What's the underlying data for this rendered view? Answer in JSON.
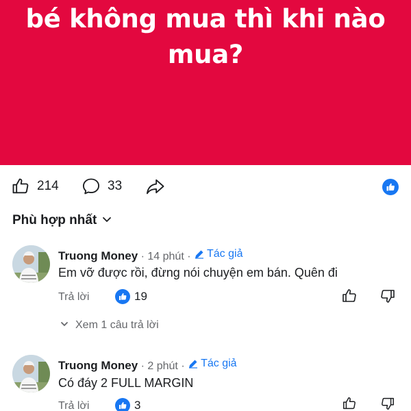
{
  "post": {
    "banner_line1": "bé không mua thì khi nào",
    "banner_line2": "mua?",
    "banner_color": "#e3083f"
  },
  "actions": {
    "like_count": "214",
    "comment_count": "33",
    "like_icon": "thumbs-up-icon",
    "comment_icon": "comment-bubble-icon",
    "share_icon": "share-arrow-icon"
  },
  "sort": {
    "label": "Phù hợp nhất"
  },
  "comments": [
    {
      "name": "Truong Money",
      "time": " · 14 phút · ",
      "author_badge": "Tác giả",
      "text": "Em vỡ được rồi, đừng nói chuyện em bán. Quên đi",
      "reply_label": "Trả lời",
      "like_count": "19"
    },
    {
      "name": "Truong Money",
      "time": " · 2 phút · ",
      "author_badge": "Tác giả",
      "text": "Có đáy 2 FULL MARGIN",
      "reply_label": "Trả lời",
      "like_count": "3"
    }
  ],
  "view_replies": {
    "label": "Xem 1 câu trả lời"
  },
  "colors": {
    "accent": "#1877f2",
    "muted": "#65676b"
  }
}
